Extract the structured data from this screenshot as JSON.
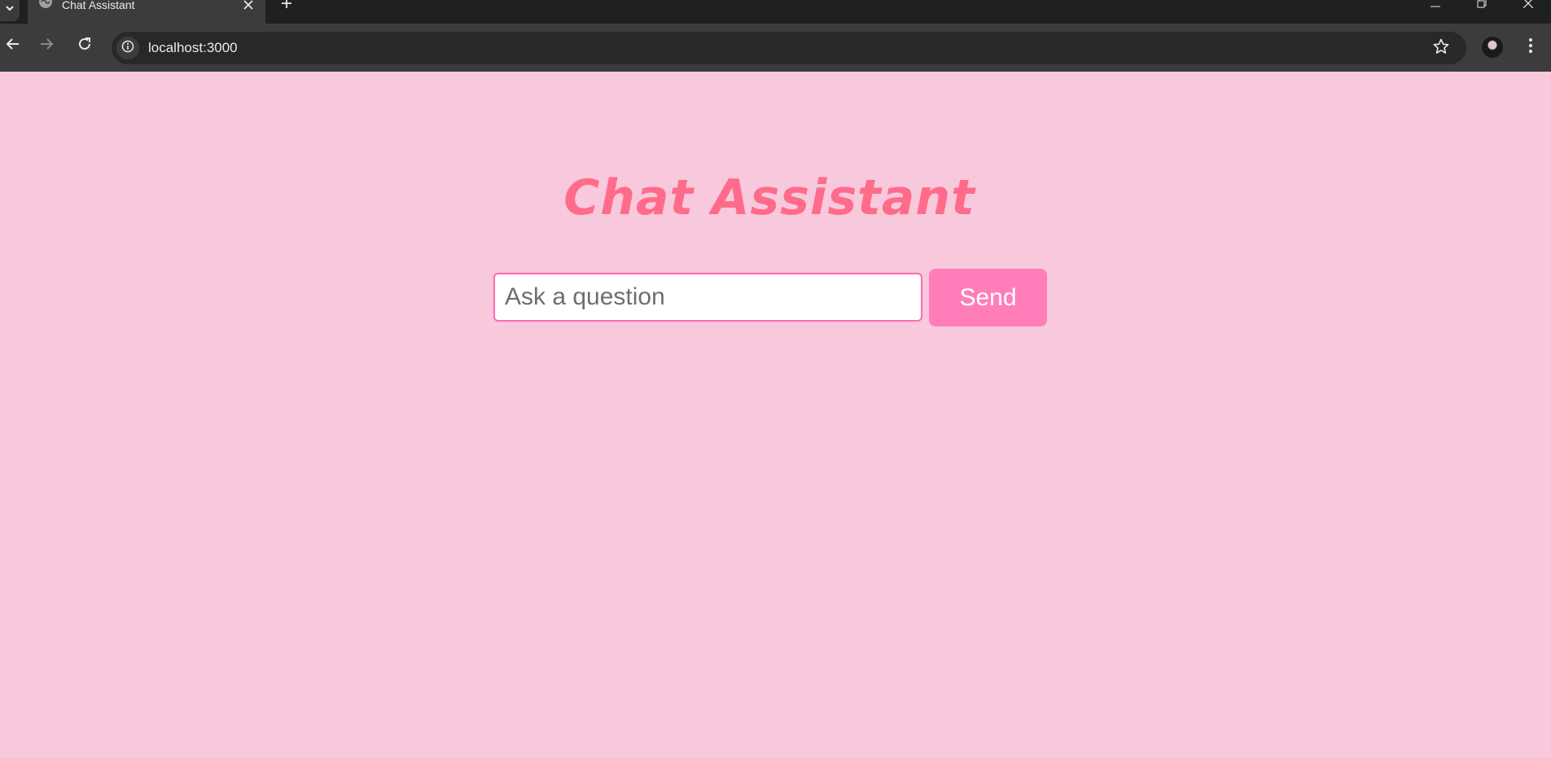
{
  "browser": {
    "tab_title": "Chat Assistant",
    "url": "localhost:3000",
    "icons": {
      "tab_search": "chevron-down-icon",
      "favicon": "globe-icon",
      "tab_close": "close-icon",
      "new_tab": "plus-icon",
      "minimize": "minimize-icon",
      "restore": "restore-icon",
      "close_window": "close-icon",
      "back": "back-arrow-icon",
      "forward": "forward-arrow-icon",
      "reload": "reload-icon",
      "site_info": "info-icon",
      "bookmark": "star-icon",
      "profile": "avatar",
      "menu": "kebab-menu-icon"
    }
  },
  "page": {
    "title": "Chat Assistant",
    "input_placeholder": "Ask a question",
    "input_value": "",
    "send_label": "Send"
  },
  "colors": {
    "page_background": "#f8c8dc",
    "title": "#ff6b8a",
    "input_border": "#ff69b4",
    "button_background": "#ff7eb9",
    "button_text": "#ffffff"
  }
}
